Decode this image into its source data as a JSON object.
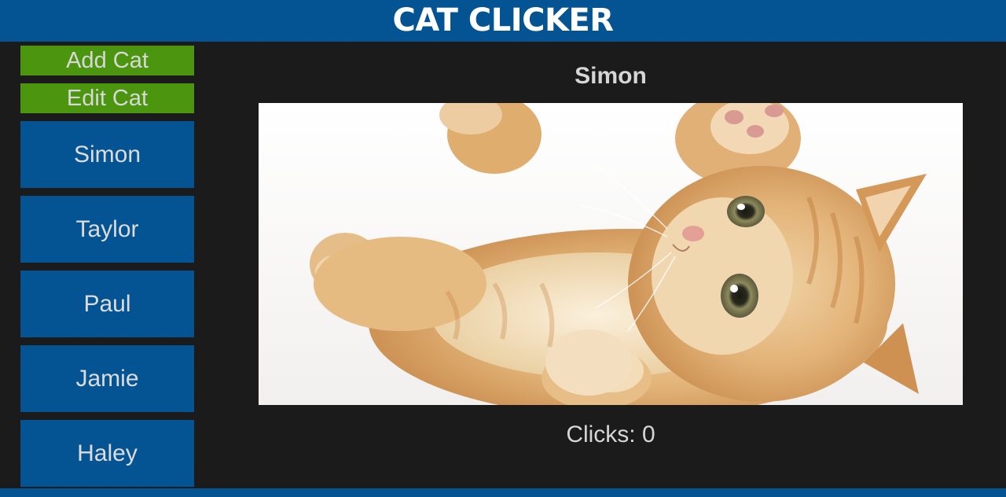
{
  "app": {
    "title": "CAT CLICKER"
  },
  "controls": {
    "add_label": "Add Cat",
    "edit_label": "Edit Cat"
  },
  "cats": [
    {
      "name": "Simon"
    },
    {
      "name": "Taylor"
    },
    {
      "name": "Paul"
    },
    {
      "name": "Jamie"
    },
    {
      "name": "Haley"
    }
  ],
  "selected": {
    "name": "Simon",
    "clicks_text": "Clicks: 0",
    "image_alt": "orange tabby kitten lying on its back with paws raised"
  },
  "colors": {
    "header": "#045493",
    "background": "#1b1b1b",
    "action_button": "#4b960e",
    "cat_item": "#045493"
  }
}
